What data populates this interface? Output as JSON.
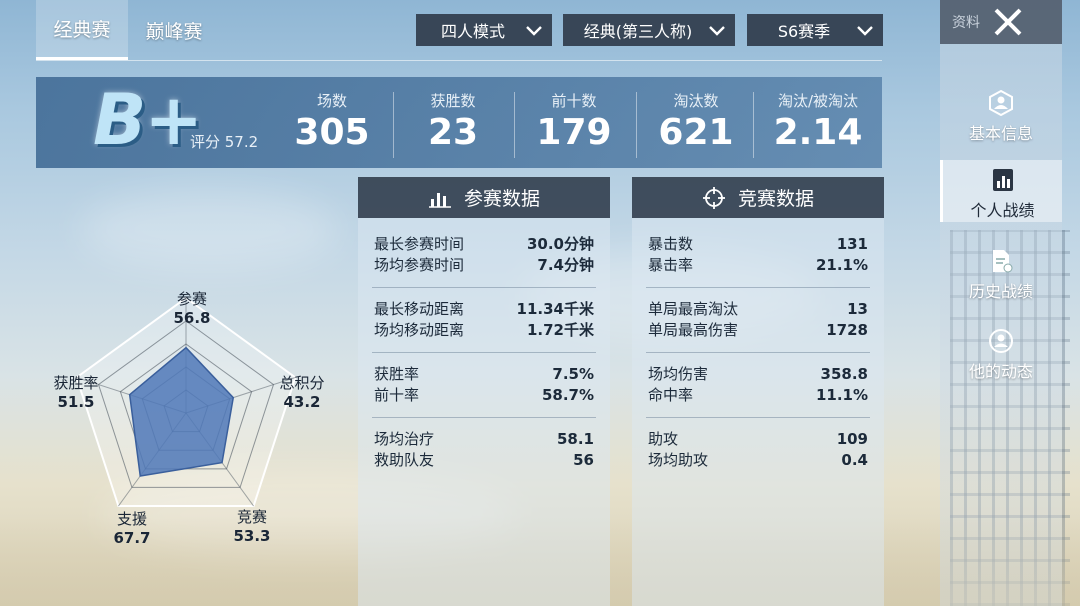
{
  "tabs": [
    {
      "label": "经典赛",
      "active": true
    },
    {
      "label": "巅峰赛",
      "active": false
    }
  ],
  "filters": {
    "mode": "四人模式",
    "map": "经典(第三人称)",
    "season": "S6赛季"
  },
  "side": {
    "top_label": "资料",
    "items": [
      {
        "label": "基本信息",
        "icon": "profile-icon"
      },
      {
        "label": "个人战绩",
        "icon": "stats-chart-icon",
        "active": true
      },
      {
        "label": "历史战绩",
        "icon": "history-doc-icon"
      },
      {
        "label": "他的动态",
        "icon": "activity-icon"
      }
    ]
  },
  "summary": {
    "grade": "B+",
    "score_label": "评分 57.2",
    "stats": [
      {
        "label": "场数",
        "value": "305"
      },
      {
        "label": "获胜数",
        "value": "23"
      },
      {
        "label": "前十数",
        "value": "179"
      },
      {
        "label": "淘汰数",
        "value": "621"
      },
      {
        "label": "淘汰/被淘汰",
        "value": "2.14"
      }
    ]
  },
  "participation": {
    "title": "参赛数据",
    "groups": [
      [
        {
          "label": "最长参赛时间",
          "value": "30.0分钟"
        },
        {
          "label": "场均参赛时间",
          "value": "7.4分钟"
        }
      ],
      [
        {
          "label": "最长移动距离",
          "value": "11.34千米"
        },
        {
          "label": "场均移动距离",
          "value": "1.72千米"
        }
      ],
      [
        {
          "label": "获胜率",
          "value": "7.5%"
        },
        {
          "label": "前十率",
          "value": "58.7%"
        }
      ],
      [
        {
          "label": "场均治疗",
          "value": "58.1"
        },
        {
          "label": "救助队友",
          "value": "56"
        }
      ]
    ]
  },
  "competition": {
    "title": "竞赛数据",
    "groups": [
      [
        {
          "label": "暴击数",
          "value": "131"
        },
        {
          "label": "暴击率",
          "value": "21.1%"
        }
      ],
      [
        {
          "label": "单局最高淘汰",
          "value": "13"
        },
        {
          "label": "单局最高伤害",
          "value": "1728"
        }
      ],
      [
        {
          "label": "场均伤害",
          "value": "358.8"
        },
        {
          "label": "命中率",
          "value": "11.1%"
        }
      ],
      [
        {
          "label": "助攻",
          "value": "109"
        },
        {
          "label": "场均助攻",
          "value": "0.4"
        }
      ]
    ]
  },
  "radar": {
    "axes": [
      {
        "label": "参赛",
        "value": "56.8",
        "score": 56.8
      },
      {
        "label": "总积分",
        "value": "43.2",
        "score": 43.2
      },
      {
        "label": "竞赛",
        "value": "53.3",
        "score": 53.3
      },
      {
        "label": "支援",
        "value": "67.7",
        "score": 67.7
      },
      {
        "label": "获胜率",
        "value": "51.5",
        "score": 51.5
      }
    ],
    "fill_color": "#4f78b8"
  }
}
